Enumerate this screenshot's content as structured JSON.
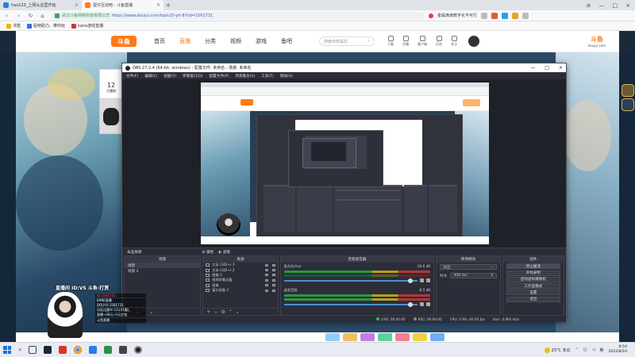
{
  "browser": {
    "tabs": [
      {
        "label": "hao123_上网从这里开始",
        "color": "#2d7be0",
        "active": false
      },
      {
        "label": "蛋仔互动吧 - 斗鱼直播",
        "color": "#ff7a17",
        "active": true
      }
    ],
    "new_tab": "+",
    "address": {
      "site_name": "武汉斗鱼网络科技有限公司",
      "url": "https://www.douyu.com/topic/D-yh-8?rid=1561731"
    },
    "news_text": "金属滴滴数字化不可行",
    "bookmarks": [
      "书签",
      "贴吧助力、带你玩",
      "kane游戏直播"
    ]
  },
  "douyu": {
    "logo": "斗鱼",
    "nav": [
      "首页",
      "直播",
      "分类",
      "视频",
      "游戏",
      "鱼吧"
    ],
    "active_nav": "直播",
    "search_placeholder": "搜索你想看的",
    "header_icons": [
      "下载",
      "开播",
      "客户端",
      "历史",
      "关注"
    ],
    "logo_right": "斗鱼",
    "logo_right_sub": "douyu.com",
    "side_card_day": "12",
    "side_card_label": "主播周"
  },
  "obs": {
    "title": "OBS 27.2.4 (64-bit, windows) - 配置文件: 未命名 - 场景: 未命名",
    "menu": [
      "文件(F)",
      "编辑(E)",
      "视图(V)",
      "停靠窗口(D)",
      "配置文件(P)",
      "场景集合(S)",
      "工具(T)",
      "帮助(H)"
    ],
    "scene_label_left": "未选择源",
    "scene_label_mid": "属性",
    "scene_label_right": "滤镜",
    "docks": {
      "scenes_title": "场景",
      "sources_title": "来源",
      "mixer_title": "音频混音器",
      "transitions_title": "转场特效",
      "controls_title": "控件"
    },
    "scenes": [
      "场景",
      "场景 2"
    ],
    "sources": [
      "文本 (GDI+) 3",
      "文本 (GDI+) 2",
      "图像 3",
      "视频采集设备",
      "图像",
      "窗口采集 4"
    ],
    "mixer": [
      {
        "name": "麦克风/Aux",
        "db": "-16.6 dB"
      },
      {
        "name": "桌面音频",
        "db": "-8.5 dB"
      }
    ],
    "transition_type": "淡出",
    "duration_label": "时长",
    "duration_value": "300 ms",
    "controls": [
      "停止推流",
      "开始录制",
      "启动虚拟摄像机",
      "工作室模式",
      "设置",
      "退出"
    ],
    "status": {
      "live_label": "LIVE:",
      "live_time": "00:00:00",
      "rec_label": "REC:",
      "rec_time": "00:00:00",
      "cpu": "CPU: 3.9%, 60.00 fps",
      "kbps": "kb/s: 4,960 kb/s"
    }
  },
  "overlay": {
    "title": "直播间 ID:VS 斗鱼-打赏",
    "lines": [
      {
        "text": "ID:1561731",
        "red": true
      },
      {
        "text": "KANE直播",
        "red": false
      },
      {
        "text": "DOUYU:1561731",
        "red": false
      },
      {
        "text": "乐队比赛中 (11)/(1番)",
        "red": false
      },
      {
        "text": "直播→30元→1元红包",
        "red": false
      },
      {
        "text": "斗鱼直播",
        "red": false
      }
    ]
  },
  "taskbar": {
    "weather_temp": "25°C 多云",
    "lang": "英",
    "time": "8:54",
    "date": "2022/8/16"
  }
}
